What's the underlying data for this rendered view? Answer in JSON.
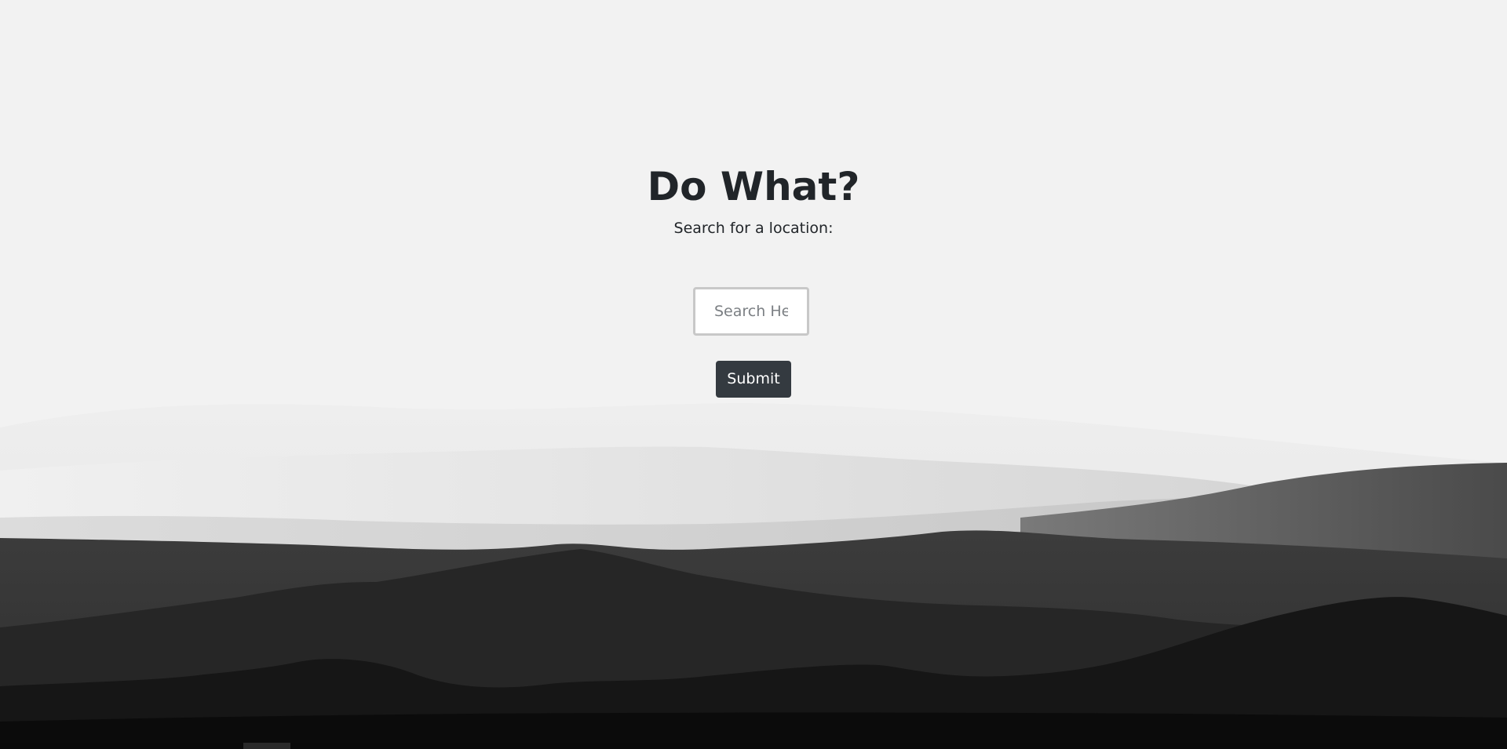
{
  "hero": {
    "title": "Do What?",
    "subtitle": "Search for a location:"
  },
  "search": {
    "placeholder": "Search Here",
    "value": ""
  },
  "submit": {
    "label": "Submit"
  },
  "colors": {
    "background": "#f2f2f2",
    "button": "#343a40",
    "text": "#212529"
  }
}
